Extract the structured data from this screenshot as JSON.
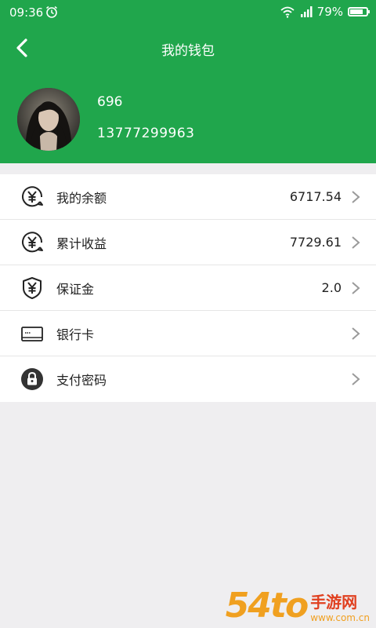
{
  "status_bar": {
    "time": "09:36",
    "battery": "79%",
    "battery_level": 0.79
  },
  "header": {
    "title": "我的钱包"
  },
  "user": {
    "name": "696",
    "phone": "13777299963"
  },
  "menu": {
    "items": [
      {
        "label": "我的余额",
        "value": "6717.54",
        "icon": "yen-circle-icon"
      },
      {
        "label": "累计收益",
        "value": "7729.61",
        "icon": "yen-circle-icon"
      },
      {
        "label": "保证金",
        "value": "2.0",
        "icon": "yen-shield-icon"
      },
      {
        "label": "银行卡",
        "value": "",
        "icon": "bank-card-icon"
      },
      {
        "label": "支付密码",
        "value": "",
        "icon": "lock-icon"
      }
    ]
  },
  "watermark": {
    "main": "54to",
    "title": "手游网",
    "url": "www.com.cn"
  },
  "colors": {
    "primary": "#20a64c",
    "background": "#efeef0"
  }
}
